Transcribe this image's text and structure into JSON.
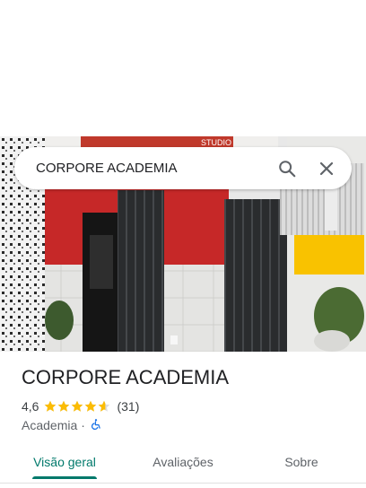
{
  "search": {
    "query": "CORPORE ACADEMIA",
    "search_icon": "search-icon",
    "clear_icon": "close-icon"
  },
  "place": {
    "name": "CORPORE ACADEMIA",
    "rating": "4,6",
    "rating_fraction": 0.92,
    "review_count": "(31)",
    "category": "Academia",
    "separator": "·",
    "accessibility_icon": "wheelchair-icon"
  },
  "photo_signage": {
    "studio_sign": "STUDIO"
  },
  "tabs": [
    {
      "label": "Visão geral",
      "active": true
    },
    {
      "label": "Avaliações",
      "active": false
    },
    {
      "label": "Sobre",
      "active": false
    }
  ],
  "colors": {
    "accent": "#00796b",
    "star": "#fbbc04",
    "wall_red": "#c62828",
    "yellow_ac": "#f9c200",
    "accessibility": "#1a73e8"
  }
}
